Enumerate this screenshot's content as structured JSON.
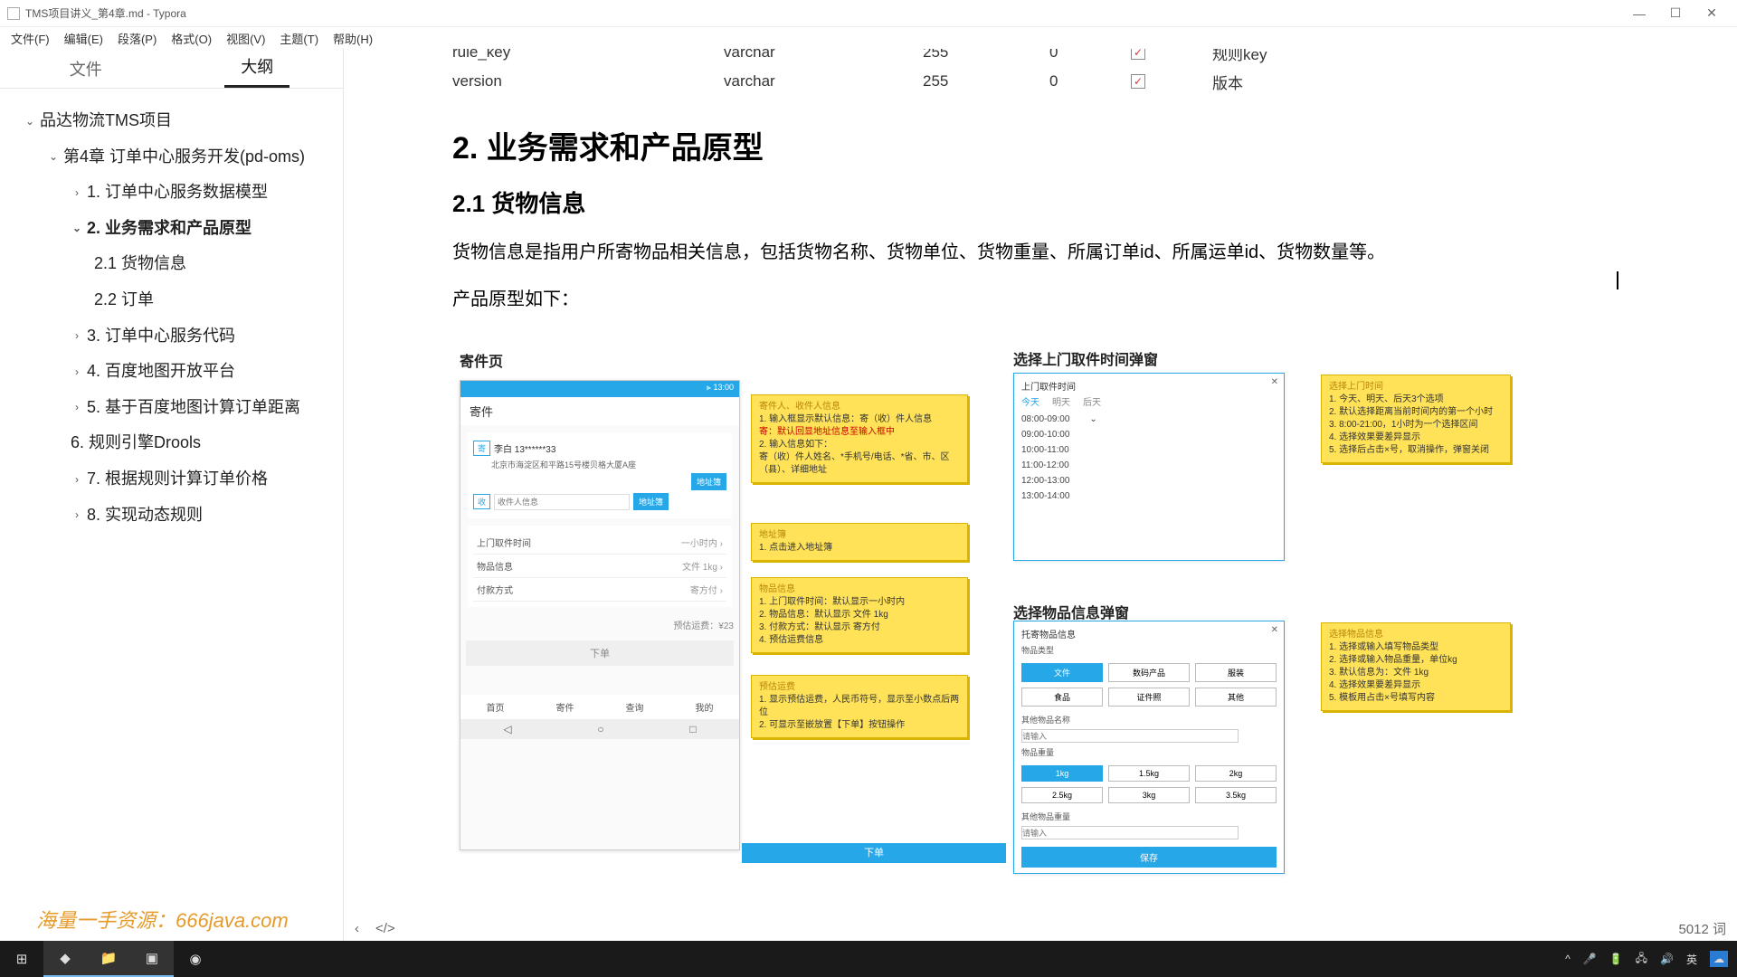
{
  "window": {
    "title": "TMS项目讲义_第4章.md - Typora"
  },
  "menus": {
    "file": "文件(F)",
    "edit": "编辑(E)",
    "paragraph": "段落(P)",
    "format": "格式(O)",
    "view": "视图(V)",
    "theme": "主题(T)",
    "help": "帮助(H)"
  },
  "sidebar": {
    "tab_files": "文件",
    "tab_outline": "大纲",
    "root": "品达物流TMS项目",
    "chapter": "第4章 订单中心服务开发(pd-oms)",
    "items": [
      "1. 订单中心服务数据模型",
      "2. 业务需求和产品原型",
      "2.1 货物信息",
      "2.2 订单",
      "3. 订单中心服务代码",
      "4. 百度地图开放平台",
      "5. 基于百度地图计算订单距离",
      "6. 规则引擎Drools",
      "7. 根据规则计算订单价格",
      "8. 实现动态规则"
    ]
  },
  "table": {
    "row1": {
      "c1": "rule_key",
      "c2": "varchar",
      "c3": "255",
      "c4": "0",
      "c6": "规则key"
    },
    "row2": {
      "c1": "version",
      "c2": "varchar",
      "c3": "255",
      "c4": "0",
      "c6": "版本"
    }
  },
  "doc": {
    "h2": "2. 业务需求和产品原型",
    "h3": "2.1 货物信息",
    "p1": "货物信息是指用户所寄物品相关信息，包括货物名称、货物单位、货物重量、所属订单id、所属运单id、货物数量等。",
    "p2": "产品原型如下："
  },
  "proto": {
    "send_page": "寄件页",
    "time_popup": "选择上门取件时间弹窗",
    "goods_popup": "选择物品信息弹窗",
    "phone_time": "⫸ 13:00",
    "phone_header": "寄件",
    "sender_line": "李白    13******33",
    "sender_addr": "北京市海淀区和平路15号楼贝格大厦A座",
    "btn_addrbook": "地址簿",
    "recv_placeholder": "收件人信息",
    "row_time": {
      "l": "上门取件时间",
      "r": "一小时内 ›"
    },
    "row_goods": {
      "l": "物品信息",
      "r": "文件 1kg ›"
    },
    "row_pay": {
      "l": "付款方式",
      "r": "寄方付 ›"
    },
    "price": "预估运费：¥23",
    "submit": "下单",
    "nav": [
      "首页",
      "寄件",
      "查询",
      "我的"
    ],
    "order_btn": "下单",
    "note1": {
      "t": "寄件人、收件人信息",
      "l1": "1. 输入框显示默认信息：寄（收）件人信息",
      "hl": "寄：默认回显地址信息至输入框中",
      "l2": "2. 输入信息如下：",
      "l3": "寄（收）件人姓名、*手机号/电话、*省、市、区（县）、详细地址"
    },
    "note2": {
      "t": "地址簿",
      "l": "1. 点击进入地址簿"
    },
    "note3": {
      "t": "物品信息",
      "l1": "1. 上门取件时间：默认显示一小时内",
      "l2": "2. 物品信息：默认显示 文件 1kg",
      "l3": "3. 付款方式：默认显示 寄方付",
      "l4": "4. 预估运费信息"
    },
    "note4": {
      "t": "预估运费",
      "l1": "1. 显示预估运费，人民币符号，显示至小数点后两位",
      "l2": "2. 可显示至嵌放置【下单】按钮操作"
    },
    "time": {
      "title": "上门取件时间",
      "tab1": "今天",
      "tab2": "明天",
      "tab3": "后天",
      "sel": "08:00-09:00",
      "s": [
        "09:00-10:00",
        "10:00-11:00",
        "11:00-12:00",
        "12:00-13:00",
        "13:00-14:00"
      ]
    },
    "note_time": {
      "t": "选择上门时间",
      "l1": "1. 今天、明天、后天3个选项",
      "l2": "2. 默认选择距离当前时间内的第一个小时",
      "l3": "3. 8:00-21:00，1小时为一个选择区间",
      "l4": "4. 选择效果要差异显示",
      "l5": "5. 选择后占击×号，取消操作，弹窗关闭"
    },
    "goods": {
      "title": "托寄物品信息",
      "sec1": "物品类型",
      "types": [
        "文件",
        "数码产品",
        "服装",
        "食品",
        "证件照",
        "其他"
      ],
      "name": "其他物品名称",
      "name_ph": "请输入",
      "sec2": "物品重量",
      "weights": [
        "1kg",
        "1.5kg",
        "2kg",
        "2.5kg",
        "3kg",
        "3.5kg"
      ],
      "other": "其他物品重量",
      "other_ph": "请输入",
      "save": "保存"
    },
    "note_goods": {
      "t": "选择物品信息",
      "l1": "1. 选择或输入填写物品类型",
      "l2": "2. 选择或输入物品重量，单位kg",
      "l3": "3. 默认信息为：文件   1kg",
      "l4": "4. 选择效果要差异显示",
      "l5": "5. 模板用占击×号填写内容"
    }
  },
  "status": {
    "words": "5012 词"
  },
  "watermark": "海量一手资源：666java.com",
  "tray": {
    "ime": "英"
  }
}
